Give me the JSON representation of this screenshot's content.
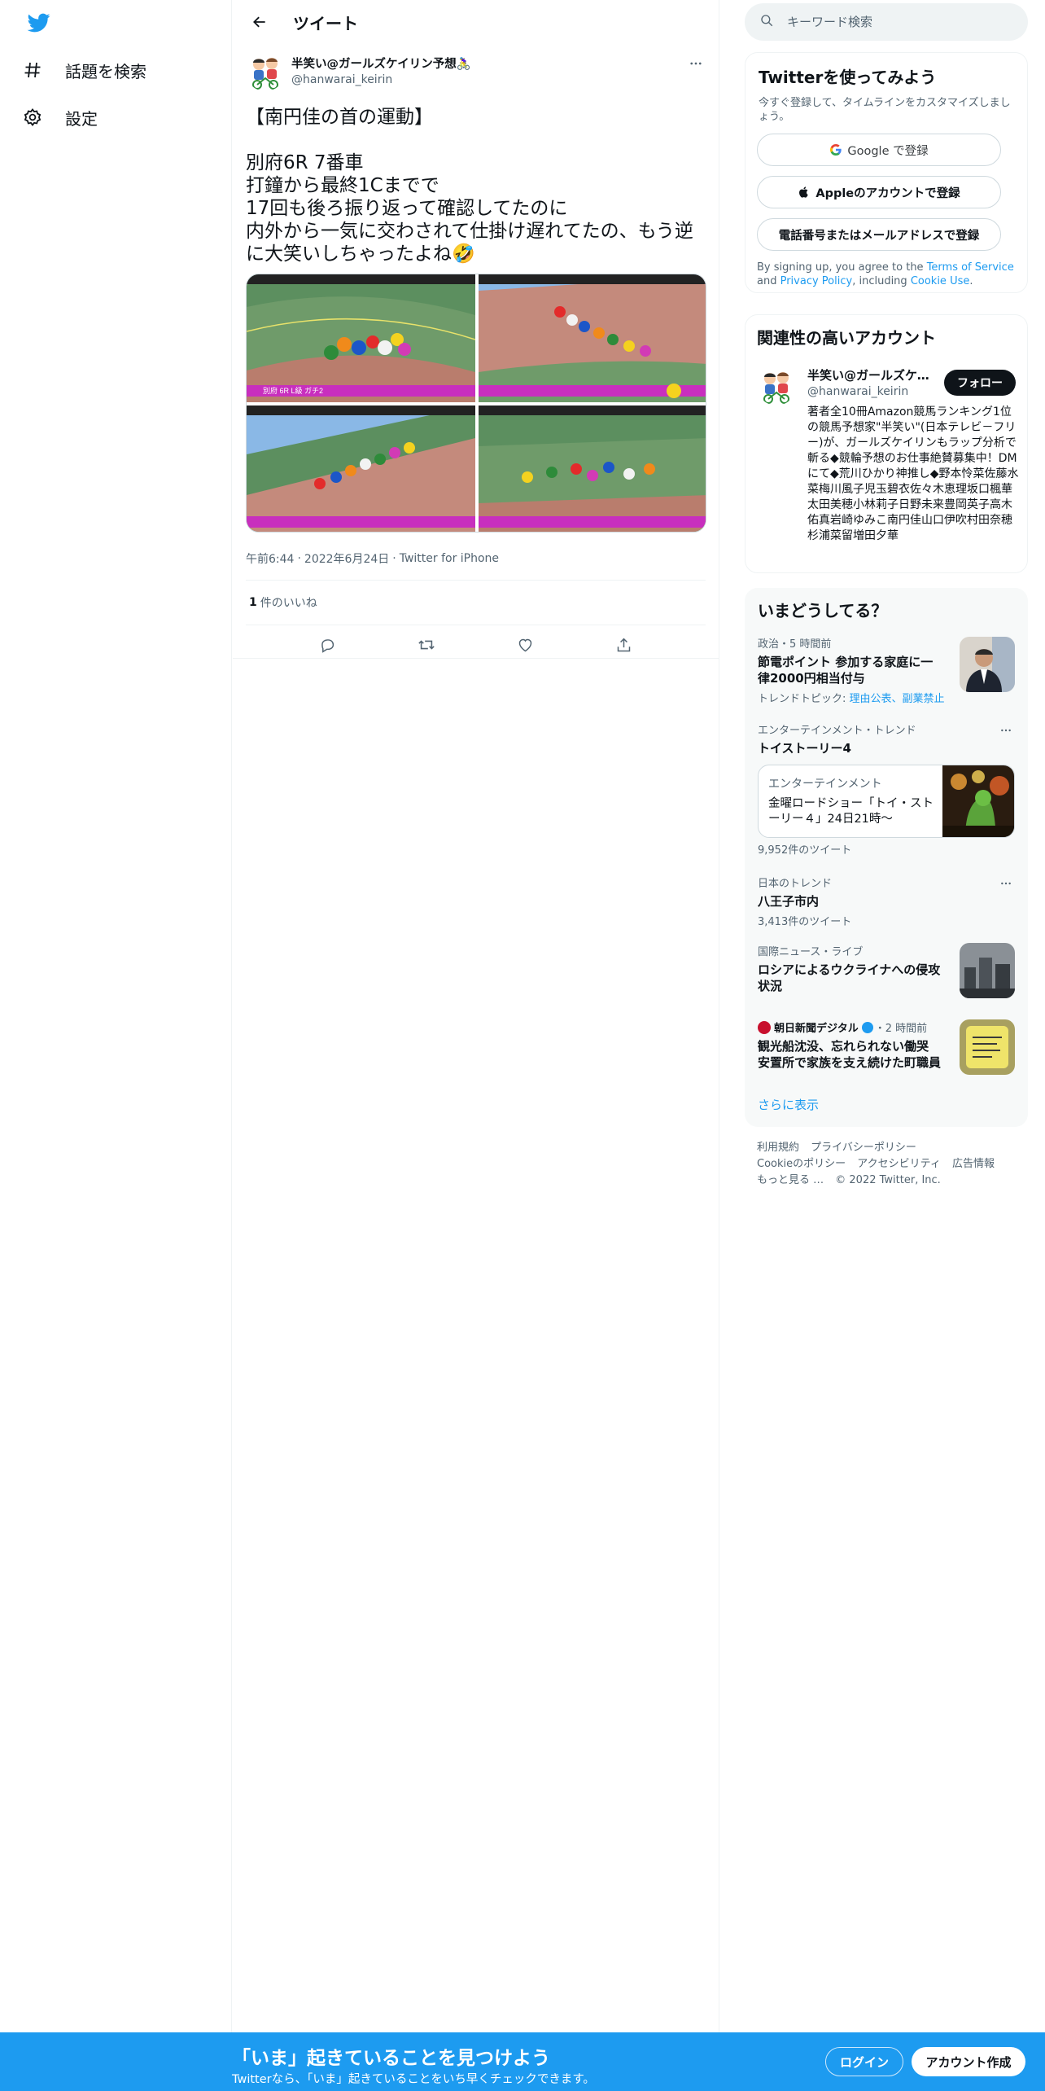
{
  "nav": {
    "items": [
      {
        "label": "話題を検索",
        "icon": "hashtag-icon"
      },
      {
        "label": "設定",
        "icon": "gear-icon"
      }
    ]
  },
  "header": {
    "title": "ツイート"
  },
  "tweet": {
    "author_name": "半笑い@ガールズケイリン予想🚴‍♀️",
    "author_handle": "@hanwarai_keirin",
    "text": "【南円佳の首の運動】\n\n別府6R 7番車\n打鐘から最終1Cまでで\n17回も後ろ振り返って確認してたのに\n内外から一気に交わされて仕掛け遅れてたの、もう逆に大笑いしちゃったよね🤣",
    "time": "午前6:44",
    "date": "2022年6月24日",
    "source": "Twitter for iPhone",
    "likes_count": "1",
    "likes_label": "件のいいね",
    "media_caption": "別府 6R L級 ガチ2"
  },
  "search": {
    "placeholder": "キーワード検索"
  },
  "signup": {
    "title": "Twitterを使ってみよう",
    "subtitle": "今すぐ登録して、タイムラインをカスタマイズしましょう。",
    "google_label": "Google で登録",
    "apple_label": "Appleのアカウントで登録",
    "phone_label": "電話番号またはメールアドレスで登録",
    "legal_prefix": "By signing up, you agree to the ",
    "terms": "Terms of Service",
    "legal_and": " and ",
    "privacy": "Privacy Policy",
    "legal_including": ", including ",
    "cookie": "Cookie Use",
    "legal_end": "."
  },
  "related": {
    "title": "関連性の高いアカウント",
    "name": "半笑い@ガールズケイリン予想",
    "handle": "@hanwarai_keirin",
    "follow": "フォロー",
    "bio": "著者全10冊Amazon競馬ランキング1位の競馬予想家\"半笑い\"(日本テレビ－フリー)が、ガールズケイリンもラップ分析で斬る◆競輪予想のお仕事絶賛募集中！DMにて◆荒川ひかり神推し◆野本怜菜佐藤水菜梅川風子児玉碧衣佐々木恵理坂口楓華太田美穂小林莉子日野未来豊岡英子高木佑真岩崎ゆみこ南円佳山口伊吹村田奈穂杉浦菜留増田夕華"
  },
  "trends": {
    "title": "いまどうしてる？",
    "items": [
      {
        "meta": "政治・5 時間前",
        "title": "節電ポイント 参加する家庭に一律2000円相当付与",
        "sub_prefix": "トレンドトピック: ",
        "sub_links": "理由公表、副業禁止"
      },
      {
        "meta": "エンターテインメント・トレンド",
        "title": "トイストーリー4",
        "card_cat": "エンターテインメント",
        "card_title": "金曜ロードショー「トイ・ストーリー４」24日21時〜",
        "count": "9,952件のツイート"
      },
      {
        "meta": "日本のトレンド",
        "title": "八王子市内",
        "count": "3,413件のツイート"
      },
      {
        "meta": "国際ニュース・ライブ",
        "title": "ロシアによるウクライナへの侵攻状況"
      },
      {
        "source": "朝日新聞デジタル",
        "time": "・2 時間前",
        "title": "観光船沈没、忘れられない働哭 安置所で家族を支え続けた町職員"
      }
    ],
    "show_more": "さらに表示"
  },
  "footer": {
    "links": [
      "利用規約",
      "プライバシーポリシー",
      "Cookieのポリシー",
      "アクセシビリティ",
      "広告情報",
      "もっと見る …"
    ],
    "copyright": "© 2022 Twitter, Inc."
  },
  "bottom": {
    "title": "「いま」起きていることを見つけよう",
    "subtitle": "Twitterなら、「いま」起きていることをいち早くチェックできます。",
    "login": "ログイン",
    "signup": "アカウント作成"
  },
  "colors": {
    "accent": "#1d9bf0",
    "text": "#0f1419",
    "muted": "#536471"
  }
}
